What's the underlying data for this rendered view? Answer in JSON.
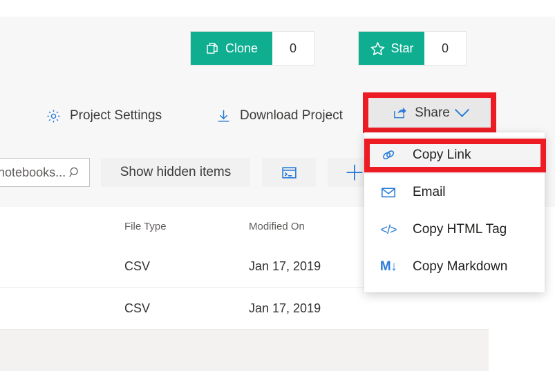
{
  "actions": [
    {
      "id": "clone",
      "label": "Clone",
      "count": "0",
      "icon": "copy-icon",
      "color": "#0fae91"
    },
    {
      "id": "star",
      "label": "Star",
      "count": "0",
      "icon": "star-icon",
      "color": "#0fae91"
    }
  ],
  "commandbar": {
    "project_settings": {
      "label": "Project Settings",
      "icon": "gear-icon"
    },
    "download_project": {
      "label": "Download Project",
      "icon": "download-icon"
    },
    "share": {
      "label": "Share",
      "icon": "share-icon",
      "chevron": "chevron-down-icon",
      "highlighted": true
    }
  },
  "toolbar": {
    "search": {
      "value": "",
      "placeholder": "Search notebooks...",
      "visible_text": "oks...",
      "icon": "search-icon"
    },
    "show_hidden_items": {
      "label": "Show hidden items"
    },
    "console_button": {
      "icon": "console-icon"
    },
    "add_button": {
      "icon": "plus-icon"
    }
  },
  "share_menu": {
    "items": [
      {
        "label": "Copy Link",
        "icon": "link-icon",
        "highlighted": true
      },
      {
        "label": "Email",
        "icon": "envelope-icon",
        "highlighted": false
      },
      {
        "label": "Copy HTML Tag",
        "icon": "code-icon",
        "highlighted": false
      },
      {
        "label": "Copy Markdown",
        "icon": "markdown-icon",
        "highlighted": false
      }
    ]
  },
  "file_table": {
    "columns": [
      "",
      "File Type",
      "Modified On"
    ],
    "rows": [
      {
        "name": "",
        "file_type": "CSV",
        "modified_on": "Jan 17, 2019"
      },
      {
        "name": "",
        "file_type": "CSV",
        "modified_on": "Jan 17, 2019"
      },
      {
        "name": "",
        "file_type": "",
        "modified_on": ""
      }
    ]
  },
  "colors": {
    "accent_teal": "#0fae91",
    "accent_blue": "#2a7cd8",
    "annotation_red": "#ed1c24",
    "header_bg": "#f7f7f7",
    "row_hover": "#f3f2f1"
  }
}
